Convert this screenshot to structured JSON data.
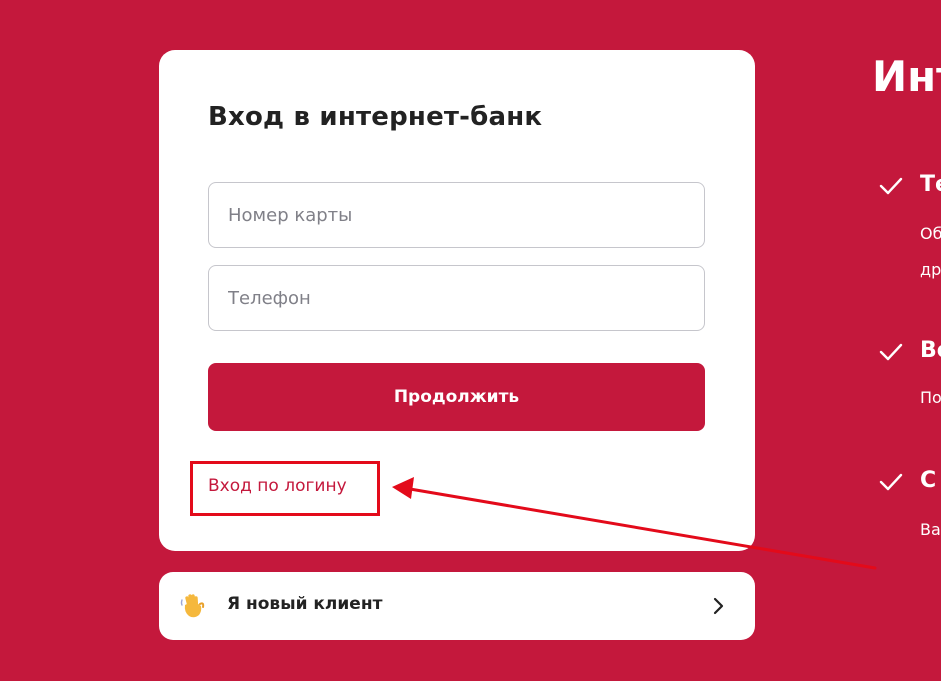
{
  "login_card": {
    "title": "Вход в интернет-банк",
    "card_number_placeholder": "Номер карты",
    "phone_placeholder": "Телефон",
    "continue_label": "Продолжить",
    "login_link_label": "Вход по логину"
  },
  "new_client": {
    "label": "Я новый клиент",
    "icon": "waving-hand-icon",
    "chevron": "chevron-right-icon"
  },
  "promo": {
    "title": "Инт",
    "features": [
      {
        "title": "Те",
        "lines": [
          "Об",
          "др"
        ]
      },
      {
        "title": "Во",
        "lines": [
          "По"
        ]
      },
      {
        "title": "С",
        "lines": [
          "Ва"
        ]
      }
    ]
  },
  "colors": {
    "brand": "#c4183c",
    "highlight": "#e30a1a",
    "card": "#ffffff"
  }
}
